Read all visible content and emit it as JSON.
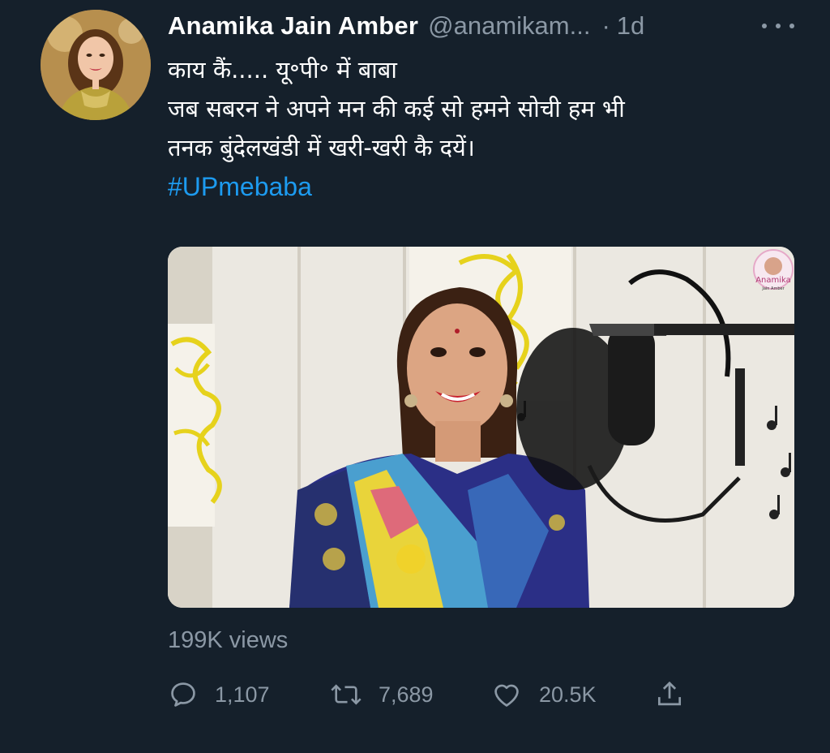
{
  "tweet": {
    "author": {
      "display_name": "Anamika Jain Amber",
      "handle": "@anamikam...",
      "separator": "·",
      "time": "1d"
    },
    "text_lines": [
      "काय कैं..... यू॰पी॰ में बाबा",
      "जब सबरन ने अपने मन की कई सो हमने सोची हम भी",
      "तनक बुंदेलखंडी में खरी-खरी कै दयें।"
    ],
    "hashtag": "#UPmebaba",
    "media": {
      "watermark_title": "Anamika",
      "watermark_subtitle": "Jain Amber"
    },
    "views": "199K views",
    "actions": {
      "replies": "1,107",
      "retweets": "7,689",
      "likes": "20.5K"
    }
  },
  "colors": {
    "background": "#15202b",
    "text": "#ffffff",
    "secondary": "#8b98a5",
    "link": "#1d9bf0"
  },
  "icons": {
    "more": "more-horizontal-icon",
    "reply": "reply-bubble-icon",
    "retweet": "retweet-arrows-icon",
    "like": "heart-outline-icon",
    "share": "share-upload-icon"
  }
}
